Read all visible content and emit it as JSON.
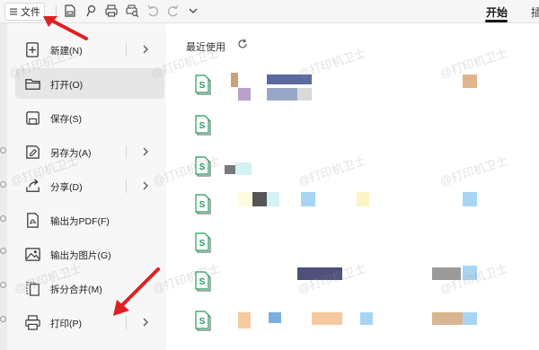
{
  "toolbar": {
    "file_label": "文件",
    "tabs": [
      {
        "label": "开始",
        "active": true
      },
      {
        "label": "插"
      }
    ]
  },
  "menu": {
    "items": [
      {
        "label": "新建(N)",
        "icon": "new-file-icon",
        "has_submenu": true
      },
      {
        "label": "打开(O)",
        "icon": "folder-icon",
        "has_submenu": false,
        "active": true
      },
      {
        "label": "保存(S)",
        "icon": "save-icon",
        "has_submenu": false
      },
      {
        "label": "另存为(A)",
        "icon": "save-as-icon",
        "has_submenu": true
      },
      {
        "label": "分享(D)",
        "icon": "share-icon",
        "has_submenu": true
      },
      {
        "label": "输出为PDF(F)",
        "icon": "pdf-icon",
        "has_submenu": false
      },
      {
        "label": "输出为图片(G)",
        "icon": "image-icon",
        "has_submenu": false
      },
      {
        "label": "拆分合并(M)",
        "icon": "split-merge-icon",
        "has_submenu": false
      },
      {
        "label": "打印(P)",
        "icon": "printer-icon",
        "has_submenu": true
      }
    ]
  },
  "recent": {
    "title": "最近使用",
    "file_type_letter": "S",
    "file_count": 8
  },
  "watermark_text": "@打印机卫士",
  "colors": {
    "accent_green": "#1e9e5a",
    "annotation_red": "#e02020",
    "active_item_bg": "#e6e6e6"
  }
}
